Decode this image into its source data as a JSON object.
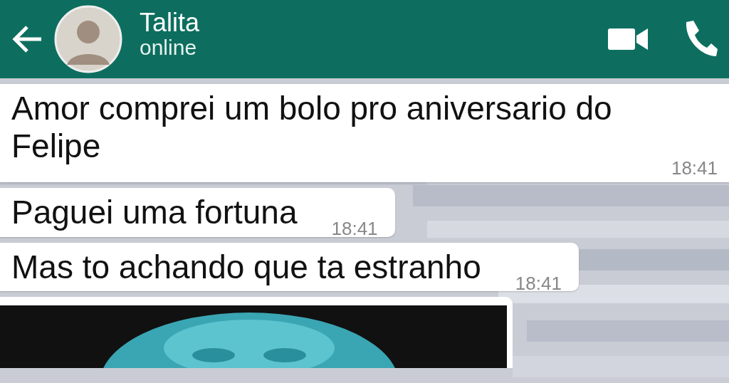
{
  "header": {
    "name": "Talita",
    "status": "online"
  },
  "messages": [
    {
      "kind": "text",
      "text": "Amor comprei um bolo pro aniversario do Felipe",
      "time": "18:41",
      "wide": true
    },
    {
      "kind": "text",
      "text": "Paguei uma fortuna",
      "time": "18:41",
      "wide": false
    },
    {
      "kind": "text",
      "text": "Mas to achando que ta estranho",
      "time": "18:41",
      "wide": false
    },
    {
      "kind": "picture"
    }
  ]
}
